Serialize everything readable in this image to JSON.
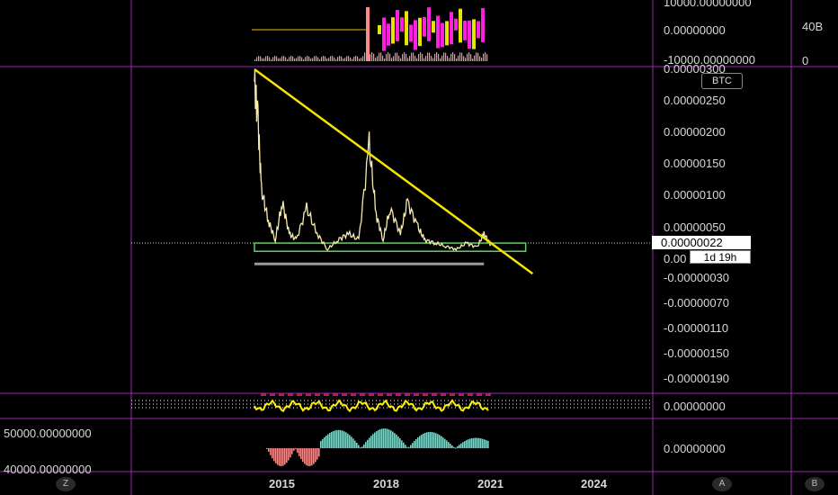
{
  "chart_data": [
    {
      "type": "line",
      "title": "",
      "currency_chip": "BTC",
      "ylim": [
        -2.1e-06,
        3e-06
      ],
      "y_ticks": [
        "0.00000300",
        "0.00000250",
        "0.00000200",
        "0.00000150",
        "0.00000100",
        "0.00000050",
        "0.00",
        "-0.00000030",
        "-0.00000070",
        "-0.00000110",
        "-0.00000150",
        "-0.00000190"
      ],
      "x_ticks": [
        "2015",
        "2018",
        "2021",
        "2024"
      ],
      "series": [
        {
          "x": [
            2014.2,
            2014.3,
            2014.4,
            2014.6,
            2014.8,
            2015.0,
            2015.2,
            2015.4,
            2015.7,
            2016.0,
            2016.3,
            2016.6,
            2016.9,
            2017.2,
            2017.5,
            2017.7,
            2017.9,
            2018.1,
            2018.4,
            2018.6,
            2018.9,
            2019.1,
            2019.4,
            2019.7,
            2020.0,
            2020.3,
            2020.6,
            2020.8,
            2021.0
          ],
          "y": [
            2.8e-06,
            2.2e-06,
            1.1e-06,
            6e-07,
            3e-07,
            9e-07,
            4e-07,
            3e-07,
            8e-07,
            4e-07,
            1.5e-07,
            3e-07,
            4e-07,
            3e-07,
            1.8e-06,
            7e-07,
            3e-07,
            8e-07,
            4e-07,
            9e-07,
            5e-07,
            3e-07,
            2.5e-07,
            2e-07,
            1.5e-07,
            2.5e-07,
            1.8e-07,
            4e-07,
            2.2e-07
          ]
        }
      ],
      "trendline": {
        "x": [
          2014.2,
          2022.2
        ],
        "y": [
          3e-06,
          -1.5e-07
        ],
        "color": "#f5e400"
      },
      "support_box": {
        "x": [
          2014.2,
          2022.0
        ],
        "y": [
          2.5e-07,
          1.2e-07
        ],
        "color": "#4caf50"
      },
      "gray_bar_y": -8e-08,
      "last_price": "0.00000022",
      "countdown": "1d 19h",
      "colors": {
        "price_line": "#f6eab0",
        "trend": "#f5e400",
        "support": "#5fd35f",
        "pane_border": "#9c27b0",
        "crosshair": "#9c27b0"
      }
    },
    {
      "type": "bar",
      "title": "",
      "y_ticks": [
        "10000.00000000",
        "0.00000000",
        "-10000.00000000"
      ],
      "volume_ticks": [
        "40B",
        "0"
      ],
      "colors": {
        "a": "#ff1fe0",
        "b": "#e5e600",
        "c": "#ff8a8a"
      }
    },
    {
      "type": "area",
      "title": "",
      "y_ticks": [
        "0.00000000"
      ],
      "colors": {
        "pos": "#fff000",
        "neg": "#c2185b",
        "dots": "#ffffff"
      }
    },
    {
      "type": "area",
      "title": "",
      "left_ticks": [
        "50000.00000000",
        "40000.00000000"
      ],
      "y_ticks": [
        "0.00000000"
      ],
      "colors": {
        "pos": "#7fd6c8",
        "neg": "#f28a8a"
      }
    }
  ],
  "ui": {
    "zoom_button": "Z",
    "auto_button": "A",
    "b_button": "B"
  }
}
